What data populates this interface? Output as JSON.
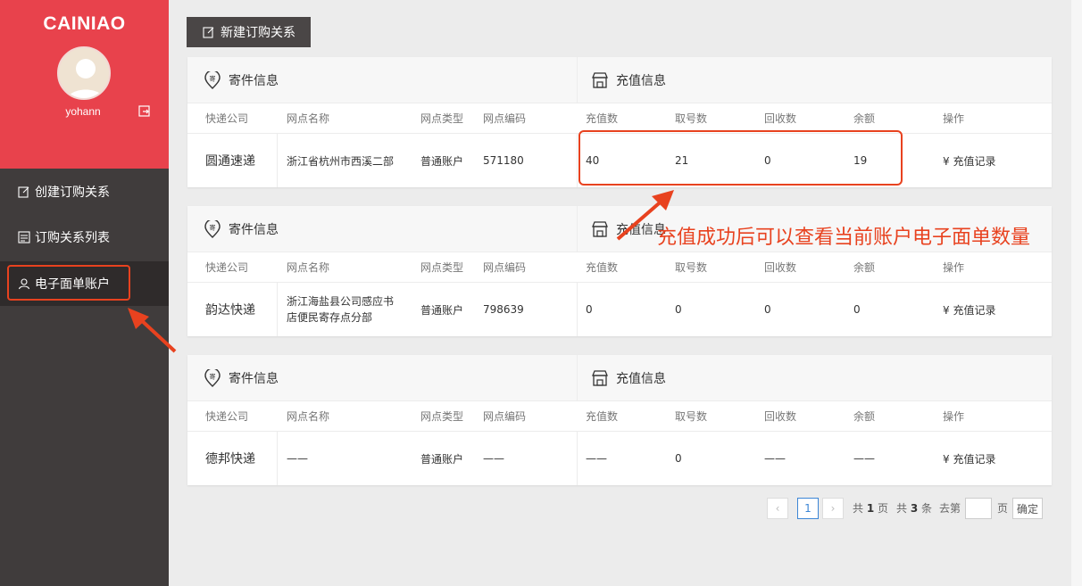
{
  "sidebar": {
    "logo": "CAINIAO",
    "username": "yohann",
    "items": [
      {
        "label": "创建订购关系"
      },
      {
        "label": "订购关系列表"
      },
      {
        "label": "电子面单账户"
      }
    ]
  },
  "toolbar": {
    "new_label": "新建订购关系"
  },
  "section_titles": {
    "sender": "寄件信息",
    "recharge": "充值信息"
  },
  "columns": [
    "快递公司",
    "网点名称",
    "网点类型",
    "网点编码",
    "充值数",
    "取号数",
    "回收数",
    "余额",
    "操作"
  ],
  "records": [
    {
      "company": "圆通速递",
      "branch_name": "浙江省杭州市西溪二部",
      "branch_type": "普通账户",
      "branch_code": "571180",
      "recharge": "40",
      "taken": "21",
      "recycled": "0",
      "balance": "19",
      "action": "¥ 充值记录"
    },
    {
      "company": "韵达快递",
      "branch_name": "浙江海盐县公司感应书店便民寄存点分部",
      "branch_type": "普通账户",
      "branch_code": "798639",
      "recharge": "0",
      "taken": "0",
      "recycled": "0",
      "balance": "0",
      "action": "¥ 充值记录"
    },
    {
      "company": "德邦快递",
      "branch_name": "——",
      "branch_type": "普通账户",
      "branch_code": "——",
      "recharge": "——",
      "taken": "0",
      "recycled": "——",
      "balance": "——",
      "action": "¥ 充值记录"
    }
  ],
  "annotation": {
    "text": "充值成功后可以查看当前账户电子面单数量"
  },
  "pagination": {
    "current_page": "1",
    "total_prefix": "共",
    "total_pages": "1",
    "pages_unit": "页",
    "total_items": "3",
    "items_unit": "条",
    "goto_label": "去第",
    "page_suffix": "页",
    "confirm_label": "确定"
  },
  "colors": {
    "brand": "#e8424c",
    "sidebar": "#403c3c",
    "annotation": "#e8421f",
    "link": "#3c86d6"
  }
}
